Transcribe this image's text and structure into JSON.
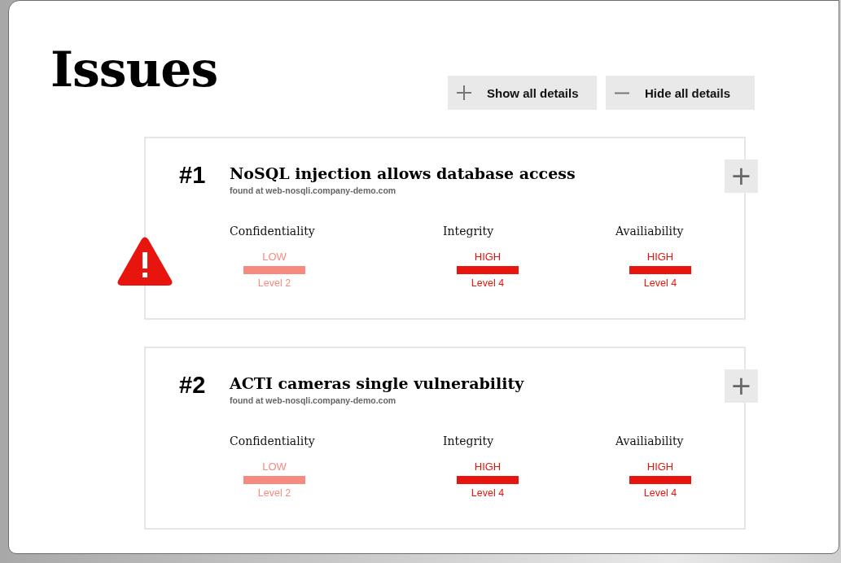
{
  "title": "Issues",
  "actions": [
    {
      "kind": "expand",
      "label": "Show all details"
    },
    {
      "kind": "collapse",
      "label": "Hide all details"
    }
  ],
  "issues": [
    {
      "number": "#1",
      "title": "NoSQL injection allows database access",
      "found_at": "found at web-nosqli.company-demo.com",
      "alert": true,
      "expand_button": "+",
      "metrics": [
        {
          "name": "Confidentiality",
          "rating": "LOW",
          "color": "#f78a80",
          "level_text": "Level 2"
        },
        {
          "name": "Integrity",
          "rating": "HIGH",
          "color": "#e8140e",
          "level_text": "Level 4"
        },
        {
          "name": "Availiability",
          "rating": "HIGH",
          "color": "#e8140e",
          "level_text": "Level 4"
        }
      ]
    },
    {
      "number": "#2",
      "title": "ACTI cameras single vulnerability",
      "found_at": "found at web-nosqli.company-demo.com",
      "alert": false,
      "expand_button": "+",
      "metrics": [
        {
          "name": "Confidentiality",
          "rating": "LOW",
          "color": "#f78a80",
          "level_text": "Level 2"
        },
        {
          "name": "Integrity",
          "rating": "HIGH",
          "color": "#e8140e",
          "level_text": "Level 4"
        },
        {
          "name": "Availiability",
          "rating": "HIGH",
          "color": "#e8140e",
          "level_text": "Level 4"
        }
      ]
    }
  ]
}
